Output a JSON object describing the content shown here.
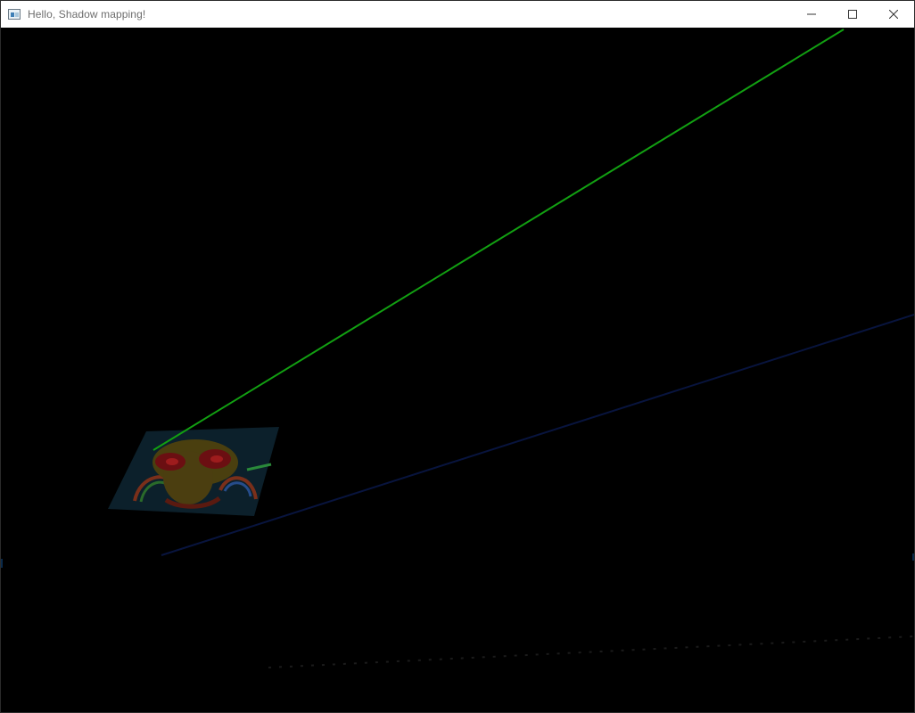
{
  "window": {
    "title": "Hello, Shadow mapping!",
    "icon": "app-window-icon",
    "controls": [
      {
        "name": "minimize-button",
        "icon": "minimize-icon"
      },
      {
        "name": "maximize-button",
        "icon": "maximize-icon"
      },
      {
        "name": "close-button",
        "icon": "close-icon"
      }
    ]
  },
  "scene": {
    "background_color": "#000000",
    "light_ray_color": "#14a014",
    "floor_edge_color": "#0f1f5a",
    "textured_quad": "cartoon-character-texture"
  }
}
